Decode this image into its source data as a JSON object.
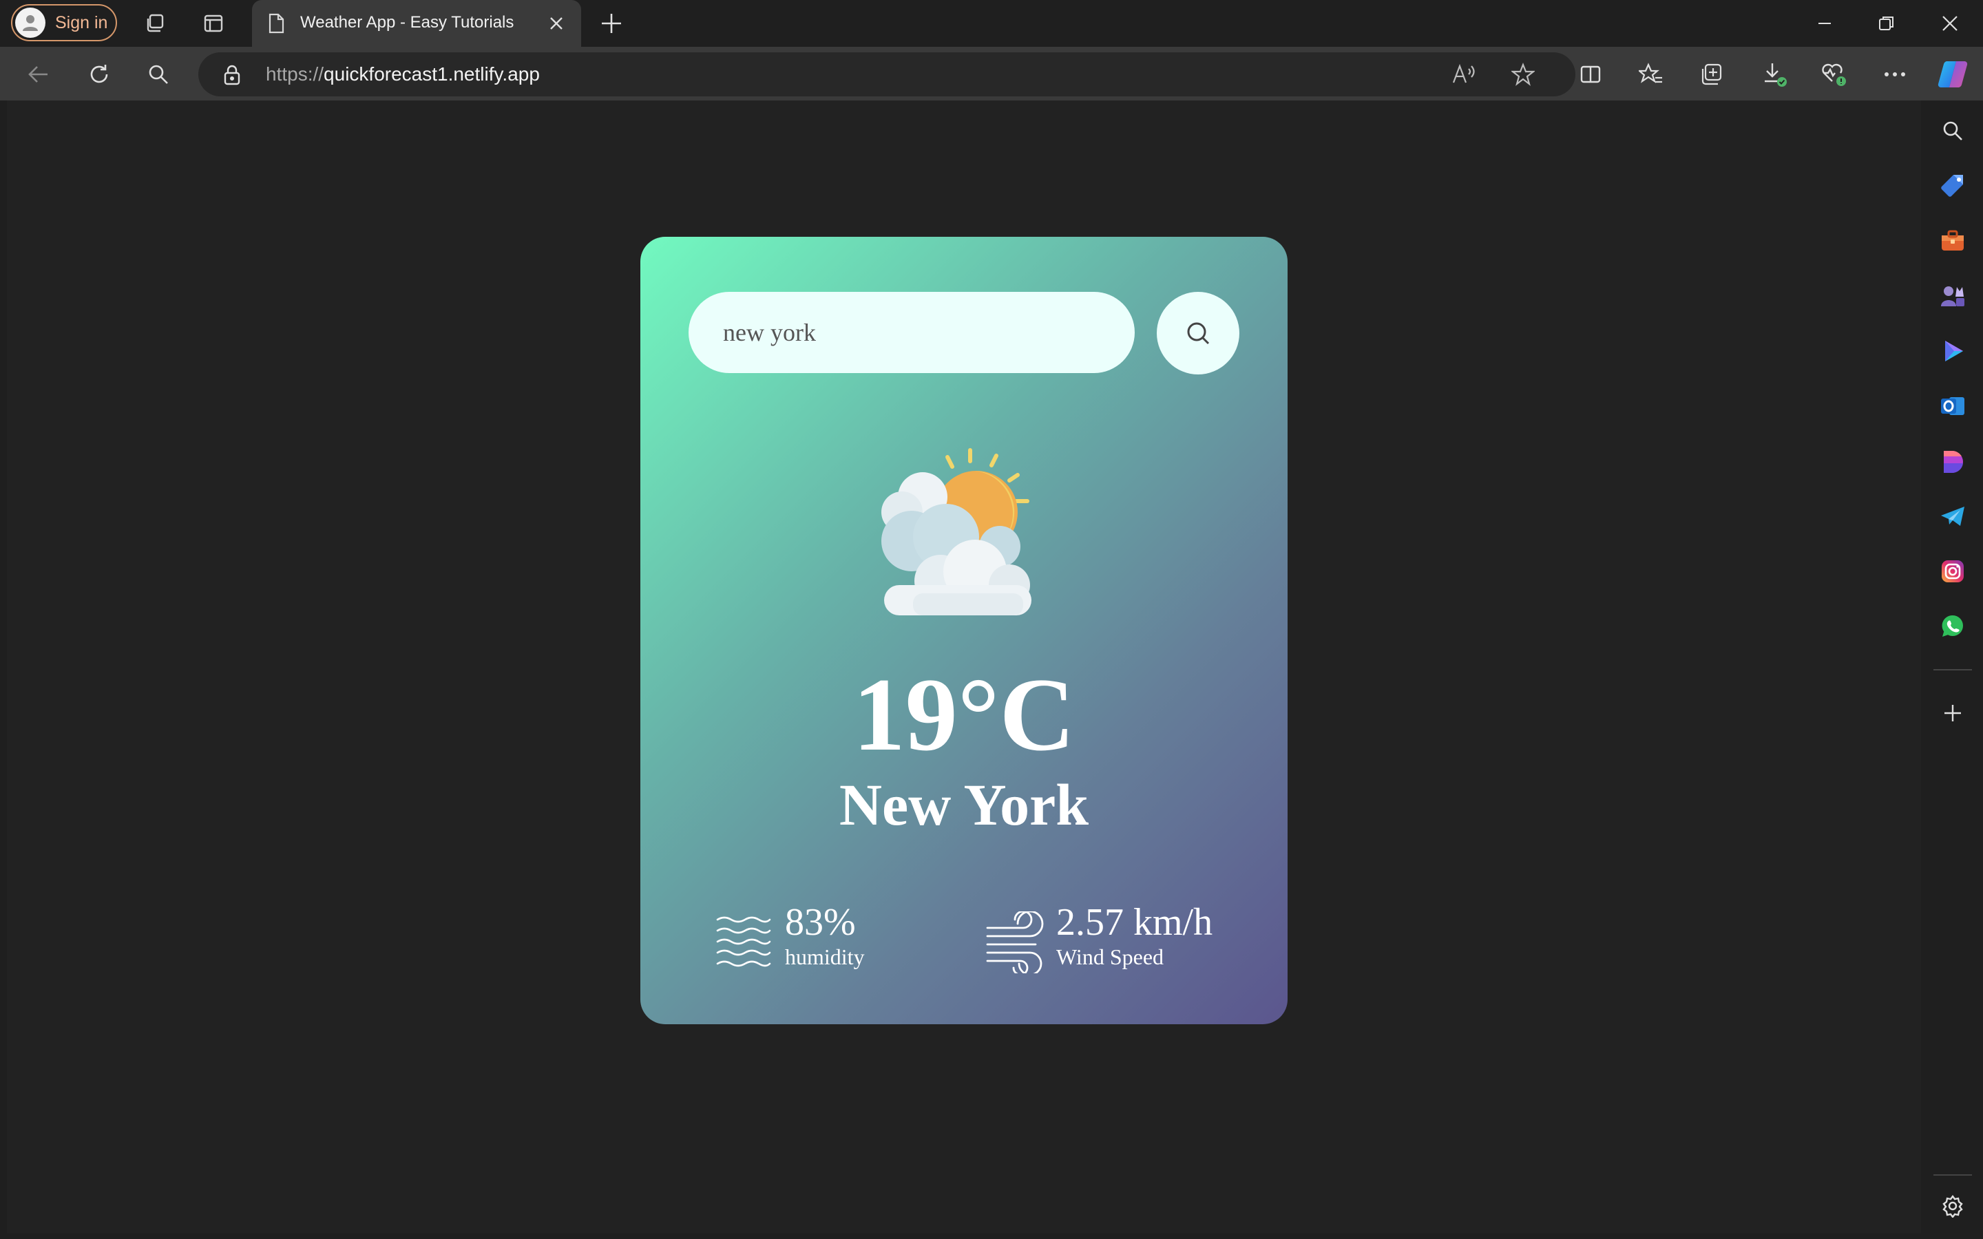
{
  "browser": {
    "signin_label": "Sign in",
    "tab": {
      "title": "Weather App - Easy Tutorials"
    },
    "address": {
      "scheme": "https://",
      "host": "quickforecast1.netlify.app"
    }
  },
  "weather_card": {
    "search": {
      "value": "new york"
    },
    "icon": "partly-cloudy-icon",
    "temperature": "19°C",
    "city": "New York",
    "humidity": {
      "value": "83%",
      "label": "humidity"
    },
    "wind": {
      "value": "2.57 km/h",
      "label": "Wind Speed"
    }
  },
  "colors": {
    "gradient_start": "#72f9c0",
    "gradient_end": "#5b568e",
    "search_bg": "#ebfffc",
    "signin_accent": "#f3b995"
  },
  "sidebar_icons": [
    "search-icon",
    "shopping-tag-icon",
    "toolbox-icon",
    "games-icon",
    "copilot-app-icon",
    "outlook-icon",
    "designer-icon",
    "telegram-icon",
    "instagram-icon",
    "whatsapp-icon",
    "add-icon",
    "settings-icon"
  ]
}
